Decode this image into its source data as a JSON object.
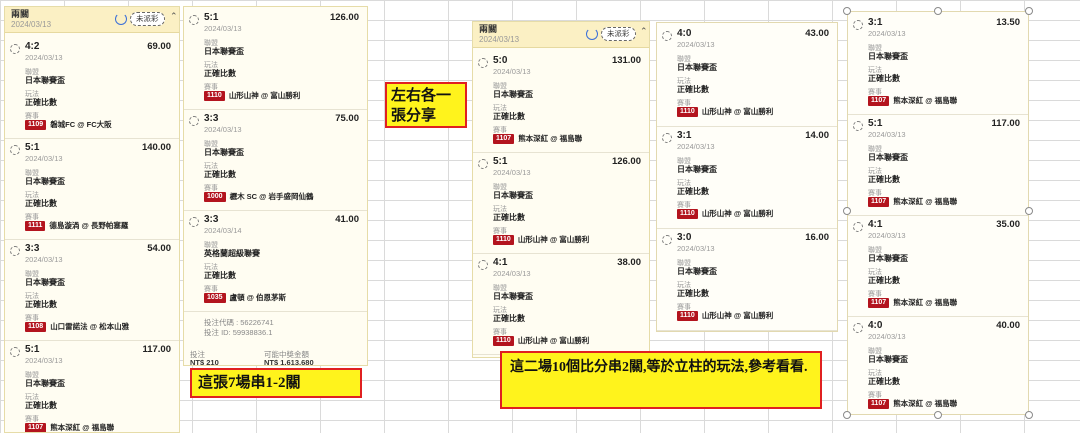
{
  "labels": {
    "league": "聯盟",
    "play": "玩法",
    "match": "賽事"
  },
  "badge_color": "#b3141e",
  "panels": {
    "p1": {
      "title": "兩關",
      "date": "2024/03/13",
      "pill": "未派彩",
      "entries": [
        {
          "score": "4:2",
          "odds": "69.00",
          "date": "2024/03/13",
          "league": "日本聯賽盃",
          "play": "正確比數",
          "code": "1109",
          "match": "磐城FC @ FC大阪"
        },
        {
          "score": "5:1",
          "odds": "140.00",
          "date": "2024/03/13",
          "league": "日本聯賽盃",
          "play": "正確比數",
          "code": "1111",
          "match": "德島漩渦 @ 長野帕塞羅"
        },
        {
          "score": "3:3",
          "odds": "54.00",
          "date": "2024/03/13",
          "league": "日本聯賽盃",
          "play": "正確比數",
          "code": "1108",
          "match": "山口雷諾法 @ 松本山雅"
        },
        {
          "score": "5:1",
          "odds": "117.00",
          "date": "2024/03/13",
          "league": "日本聯賽盃",
          "play": "正確比數",
          "code": "1107",
          "match": "熊本深紅 @ 福島聯"
        }
      ]
    },
    "p2": {
      "entries": [
        {
          "score": "5:1",
          "odds": "126.00",
          "date": "2024/03/13",
          "league": "日本聯賽盃",
          "play": "正確比數",
          "code": "1110",
          "match": "山形山神 @ 富山勝利"
        },
        {
          "score": "3:3",
          "odds": "75.00",
          "date": "2024/03/13",
          "league": "日本聯賽盃",
          "play": "正確比數",
          "code": "1000",
          "match": "櫪木 SC @ 岩手盛岡仙鶴"
        },
        {
          "score": "3:3",
          "odds": "41.00",
          "date": "2024/03/14",
          "league": "英格蘭超級聯賽",
          "play": "正確比數",
          "code": "1035",
          "match": "盧頓 @ 伯恩茅斯"
        }
      ],
      "ref_label": "投注代碼 : 56226741",
      "id_label": "投注 ID: 59938836.1",
      "stake_label": "投注",
      "stake_value": "NT$ 210",
      "payout_label": "可能中獎金額",
      "payout_value": "NT$ 1,613,680"
    },
    "p3": {
      "title": "兩關",
      "date": "2024/03/13",
      "pill": "未派彩",
      "entries": [
        {
          "score": "5:0",
          "odds": "131.00",
          "date": "2024/03/13",
          "league": "日本聯賽盃",
          "play": "正確比數",
          "code": "1107",
          "match": "熊本深紅 @ 福島聯"
        },
        {
          "score": "5:1",
          "odds": "126.00",
          "date": "2024/03/13",
          "league": "日本聯賽盃",
          "play": "正確比數",
          "code": "1110",
          "match": "山形山神 @ 富山勝利"
        },
        {
          "score": "4:1",
          "odds": "38.00",
          "date": "2024/03/13",
          "league": "日本聯賽盃",
          "play": "正確比數",
          "code": "1110",
          "match": "山形山神 @ 富山勝利"
        }
      ]
    },
    "p4": {
      "entries": [
        {
          "score": "4:0",
          "odds": "43.00",
          "date": "2024/03/13",
          "league": "日本聯賽盃",
          "play": "正確比數",
          "code": "1110",
          "match": "山形山神 @ 富山勝利"
        },
        {
          "score": "3:1",
          "odds": "14.00",
          "date": "2024/03/13",
          "league": "日本聯賽盃",
          "play": "正確比數",
          "code": "1110",
          "match": "山形山神 @ 富山勝利"
        },
        {
          "score": "3:0",
          "odds": "16.00",
          "date": "2024/03/13",
          "league": "日本聯賽盃",
          "play": "正確比數",
          "code": "1110",
          "match": "山形山神 @ 富山勝利"
        }
      ]
    },
    "p5": {
      "entries": [
        {
          "score": "3:1",
          "odds": "13.50",
          "date": "2024/03/13",
          "league": "日本聯賽盃",
          "play": "正確比數",
          "code": "1107",
          "match": "熊本深紅 @ 福島聯"
        },
        {
          "score": "5:1",
          "odds": "117.00",
          "date": "2024/03/13",
          "league": "日本聯賽盃",
          "play": "正確比數",
          "code": "1107",
          "match": "熊本深紅 @ 福島聯"
        },
        {
          "score": "4:1",
          "odds": "35.00",
          "date": "2024/03/13",
          "league": "日本聯賽盃",
          "play": "正確比數",
          "code": "1107",
          "match": "熊本深紅 @ 福島聯"
        },
        {
          "score": "4:0",
          "odds": "40.00",
          "date": "2024/03/13",
          "league": "日本聯賽盃",
          "play": "正確比數",
          "code": "1107",
          "match": "熊本深紅 @ 福島聯"
        }
      ]
    }
  },
  "notes": {
    "left_right": "左右各一張分享",
    "seven_legs": "這張7場串1-2關",
    "ten_scores": "這二場10個比分串2關,等於立柱的玩法,參考看看."
  }
}
